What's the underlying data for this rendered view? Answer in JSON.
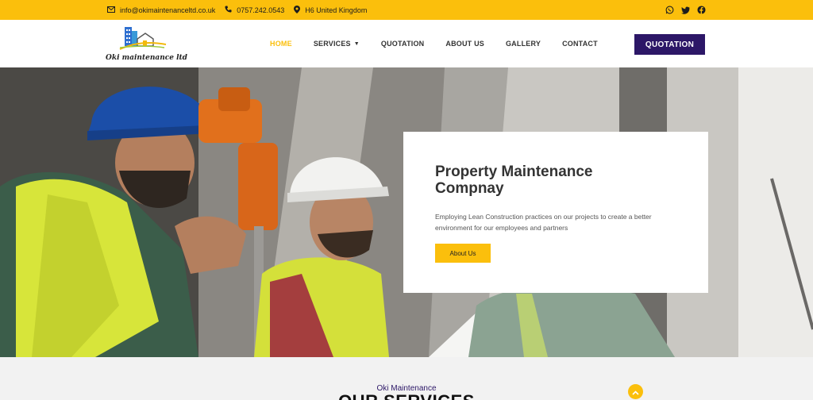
{
  "topbar": {
    "email": "info@okimaintenanceltd.co.uk",
    "phone": "0757.242.0543",
    "location": "H6 United Kingdom",
    "social_icons": [
      "whatsapp-icon",
      "twitter-icon",
      "facebook-icon"
    ]
  },
  "header": {
    "logo_text": "Oki maintenance ltd",
    "nav": [
      {
        "label": "HOME",
        "active": true
      },
      {
        "label": "SERVICES",
        "has_dropdown": true
      },
      {
        "label": "QUOTATION"
      },
      {
        "label": "ABOUT US"
      },
      {
        "label": "GALLERY"
      },
      {
        "label": "CONTACT"
      }
    ],
    "cta_label": "QUOTATION"
  },
  "hero": {
    "title": "Property Maintenance Compnay",
    "text": "Employing Lean Construction practices on our projects to create a better environment for our employees and partners",
    "button_label": "About Us"
  },
  "services": {
    "subtitle": "Oki Maintenance",
    "title": "OUR SERVICES"
  },
  "colors": {
    "accent": "#fbbf0c",
    "brand": "#2c1767"
  }
}
